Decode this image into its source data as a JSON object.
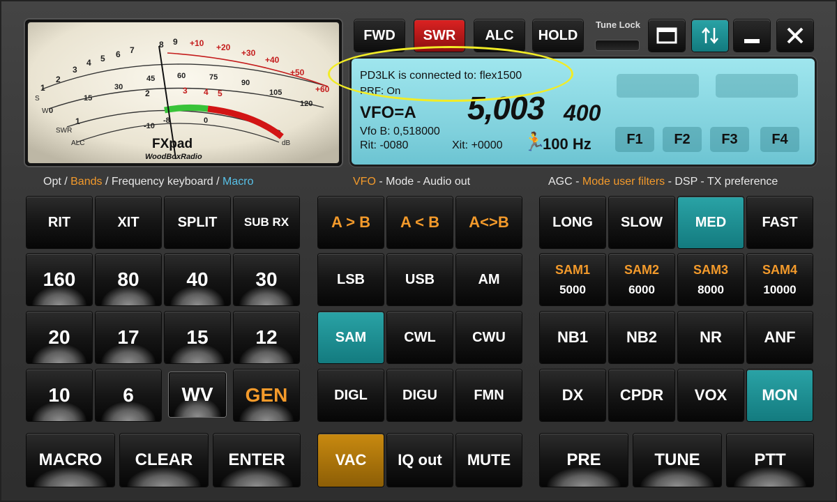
{
  "meter": {
    "s_scale": [
      "1",
      "3",
      "5",
      "7",
      "9",
      "+10",
      "+20",
      "+30",
      "+40",
      "+50",
      "+60"
    ],
    "s_scale_mid": [
      "2",
      "4",
      "6",
      "8"
    ],
    "s_label": "S",
    "w_label": "W",
    "w_scale": [
      "0",
      "15",
      "30",
      "45",
      "60",
      "75",
      "90",
      "105",
      "120"
    ],
    "swr_label": "SWR",
    "swr_scale": [
      "1",
      "2",
      "3",
      "4",
      "5"
    ],
    "alc_label": "ALC",
    "alc_scale": [
      "-10",
      "-8",
      "0"
    ],
    "db_label": "dB",
    "brand": "FXpad",
    "brand_sub": "WoodBoxRadio"
  },
  "top_buttons": {
    "fwd": "FWD",
    "swr": "SWR",
    "alc": "ALC",
    "hold": "HOLD",
    "tune_lock": "Tune Lock"
  },
  "lcd": {
    "connection": "PD3LK is connected to: flex1500",
    "prf": "PRF: On",
    "vfo": "VFO=A",
    "freq_main": "5,003",
    "freq_sub": "400",
    "vfo_b": "Vfo B: 0,518000",
    "rit": "Rit: -0080",
    "xit": "Xit: +0000",
    "step": "100 Hz",
    "fkeys": [
      "F1",
      "F2",
      "F3",
      "F4"
    ]
  },
  "sections": {
    "left": {
      "a": "Opt / ",
      "b": "Bands",
      "c": " / Frequency keyboard / ",
      "d": "Macro"
    },
    "mid": {
      "a": "VFO",
      "b": " - Mode - Audio out"
    },
    "right": {
      "a": "AGC - ",
      "b": "Mode user filters",
      "c": " - DSP - TX preference"
    }
  },
  "left_grid": {
    "row1": [
      "RIT",
      "XIT",
      "SPLIT",
      "SUB RX"
    ],
    "row2": [
      "160",
      "80",
      "40",
      "30"
    ],
    "row3": [
      "20",
      "17",
      "15",
      "12"
    ],
    "row4": [
      "10",
      "6",
      "WV",
      "GEN"
    ],
    "row5": [
      "MACRO",
      "CLEAR",
      "ENTER"
    ]
  },
  "mid_grid": {
    "row1": [
      "A > B",
      "A < B",
      "A<>B"
    ],
    "row2": [
      "LSB",
      "USB",
      "AM"
    ],
    "row3": [
      "SAM",
      "CWL",
      "CWU"
    ],
    "row4": [
      "DIGL",
      "DIGU",
      "FMN"
    ],
    "row5": [
      "VAC",
      "IQ out",
      "MUTE"
    ]
  },
  "right_grid": {
    "row1": [
      "LONG",
      "SLOW",
      "MED",
      "FAST"
    ],
    "row2": [
      {
        "top": "SAM1",
        "bot": "5000"
      },
      {
        "top": "SAM2",
        "bot": "6000"
      },
      {
        "top": "SAM3",
        "bot": "8000"
      },
      {
        "top": "SAM4",
        "bot": "10000"
      }
    ],
    "row3": [
      "NB1",
      "NB2",
      "NR",
      "ANF"
    ],
    "row4": [
      "DX",
      "CPDR",
      "VOX",
      "MON"
    ],
    "row5": [
      "PRE",
      "TUNE",
      "PTT"
    ]
  },
  "colors": {
    "accent_orange": "#f39a2b",
    "accent_blue": "#58c1e8",
    "teal": "#1c9196",
    "red": "#c81a1a",
    "gold": "#b07a0c",
    "highlight": "#f2ec25"
  }
}
